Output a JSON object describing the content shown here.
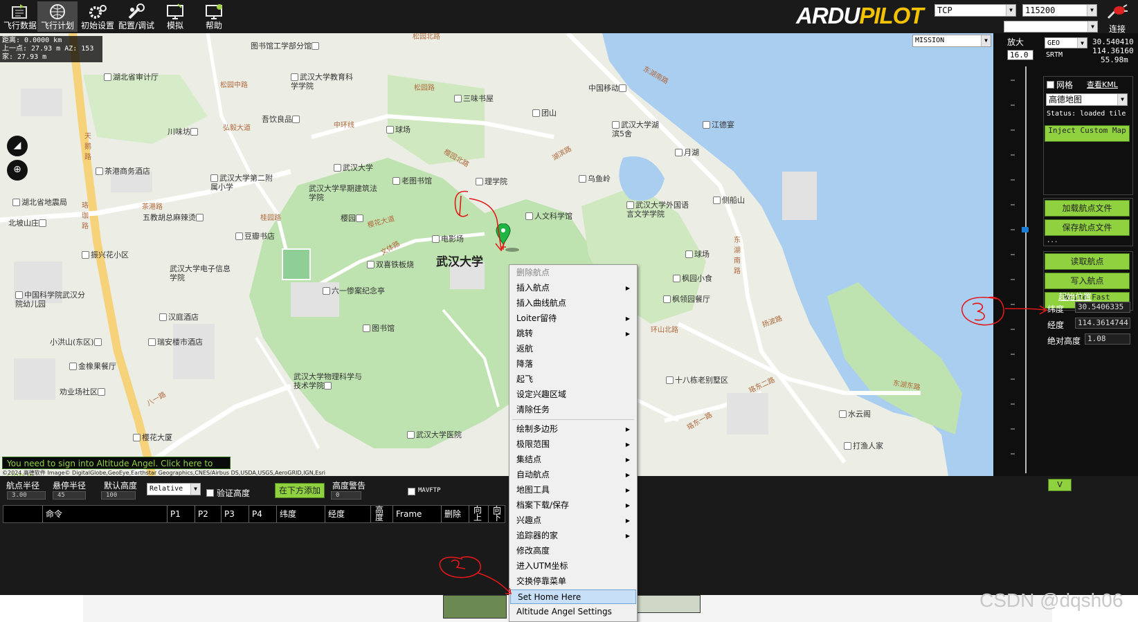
{
  "toolbar": {
    "items": [
      {
        "label": "飞行数据",
        "icon": "flight-data-icon"
      },
      {
        "label": "飞行计划",
        "icon": "flight-plan-icon"
      },
      {
        "label": "初始设置",
        "icon": "initial-setup-icon"
      },
      {
        "label": "配置/调试",
        "icon": "config-tuning-icon"
      },
      {
        "label": "模拟",
        "icon": "simulation-icon"
      },
      {
        "label": "帮助",
        "icon": "help-icon"
      }
    ],
    "active_index": 1,
    "logo_part1": "ARDU",
    "logo_part2": "PILOT",
    "link_type": "TCP",
    "baud_rate": "115200",
    "connect_label": "连接"
  },
  "map_info": {
    "line1": "距离: 0.0000 km",
    "line2": "上一点: 27.93 m AZ: 153",
    "line3": "家: 27.93 m"
  },
  "map_places": {
    "p1": "图书馆工学部分馆",
    "p2": "湖北省审计厅",
    "p3": "武汉大学教育科学学院",
    "p4": "中国移动",
    "p5": "三味书屋",
    "p6": "团山",
    "p7": "吾饮良品",
    "p8": "川味坊",
    "p9": "球场",
    "p10": "武汉大学湖滨5舍",
    "p11": "江德宴",
    "p12": "茶港商务酒店",
    "p13": "武汉大学",
    "p14": "月湖",
    "p15": "乌鱼岭",
    "p16": "武汉大学第二附属小学",
    "p17": "老图书馆",
    "p18": "理学院",
    "p19": "武汉大学早期建筑法学院",
    "p20": "湖北省地震局",
    "p21": "武汉大学外国语言文学学院",
    "p22": "侧船山",
    "p23": "北坡山庄",
    "p24": "五教胡总麻辣烫",
    "p25": "樱园",
    "p26": "人文科学馆",
    "p27": "豆瓣书店",
    "p28": "电影场",
    "p29": "振兴花小区",
    "p30": "双喜铁板烧",
    "p31": "武汉大学",
    "p32": "球场",
    "p33": "武汉大学电子信息学院",
    "p34": "枫园小食",
    "p35": "中国科学院武汉分院幼儿园",
    "p36": "六一惨案纪念亭",
    "p37": "枫领园餐厅",
    "p38": "汉庭酒店",
    "p39": "图书馆",
    "p40": "小洪山(东区)",
    "p41": "瑞安楼市酒店",
    "p42": "金橡果餐厅",
    "p43": "十八栋老别墅区",
    "p44": "劝业场社区",
    "p45": "武汉大学物理科学与技术学院",
    "p46": "水云阁",
    "p47": "樱花大厦",
    "p48": "武汉大学医院",
    "p49": "打渔人家"
  },
  "map_roads": {
    "r1": "松园北路",
    "r2": "东湖南路",
    "r3": "松园中路",
    "r4": "松园路",
    "r5": "中环线",
    "r6": "弘毅大道",
    "r7": "天鹅路",
    "r8": "樱园北路",
    "r9": "湖滨路",
    "r10": "珞珈路",
    "r11": "茶港路",
    "r12": "樱花大道",
    "r13": "桂园路",
    "r14": "文体路",
    "r15": "东湖南路",
    "r16": "扬波路",
    "r17": "环山北路",
    "r18": "东湖东路",
    "r19": "珞东二路",
    "r20": "八一路",
    "r21": "珞东一路"
  },
  "map_banner": "You need to sign into Altitude Angel. Click here to sign in.",
  "map_attrib": "©2024 高德软件 Image© DigitalGlobe,GeoEye,Earthstar Geographics,CNES/Airbus DS,USDA,USGS,AeroGRID,IGN,Esri",
  "right_panel": {
    "mission_select": "MISSION",
    "zoom_label": "放大",
    "zoom_value": "16.0",
    "coord_mode": "GEO",
    "coord_lat": "30.540410",
    "coord_lng": "114.36160",
    "srtm_label": "SRTM",
    "srtm_alt": "55.98m",
    "grid_label": "网格",
    "kml_link": "查看KML",
    "map_provider": "高德地图",
    "status_text": "Status: loaded tile",
    "inject_btn": "Inject Custom Map",
    "load_wp": "加载航点文件",
    "save_wp": "保存航点文件",
    "dots": "...",
    "read_wp": "读取航点",
    "write_wp": "写入航点",
    "write_fast": "Write Fast",
    "home_title": "起始位置",
    "lat_label": "纬度",
    "lat_value": "30.5406335",
    "lng_label": "经度",
    "lng_value": "114.3614744",
    "alt_label": "绝对高度",
    "alt_value": "1.08",
    "collapse_btn": "V"
  },
  "bottom_panel": {
    "wp_radius_label": "航点半径",
    "wp_radius": "3.00",
    "loiter_radius_label": "悬停半径",
    "loiter_radius": "45",
    "default_alt_label": "默认高度",
    "default_alt": "100",
    "alt_frame": "Relative",
    "verify_alt": "验证高度",
    "add_below": "在下方添加",
    "alt_warn_label": "高度警告",
    "alt_warn": "0",
    "mavftp": "MAVFTP",
    "columns": [
      "命令",
      "P1",
      "P2",
      "P3",
      "P4",
      "纬度",
      "经度",
      "高度",
      "Frame",
      "删除",
      "向上",
      "向下"
    ]
  },
  "context_menu": [
    {
      "label": "删除航点",
      "disabled": true,
      "sub": false
    },
    {
      "label": "插入航点",
      "sub": true
    },
    {
      "label": "插入曲线航点",
      "sub": false
    },
    {
      "label": "Loiter留待",
      "sub": true
    },
    {
      "label": "跳转",
      "sub": true
    },
    {
      "label": "返航",
      "sub": false
    },
    {
      "label": "降落",
      "sub": false
    },
    {
      "label": "起飞",
      "sub": false
    },
    {
      "label": "设定兴趣区域",
      "sub": false
    },
    {
      "label": "清除任务",
      "sub": false
    },
    {
      "label": "绘制多边形",
      "sub": true
    },
    {
      "label": "极限范围",
      "sub": true
    },
    {
      "label": "集结点",
      "sub": true
    },
    {
      "label": "自动航点",
      "sub": true
    },
    {
      "label": "地图工具",
      "sub": true
    },
    {
      "label": "档案下载/保存",
      "sub": true
    },
    {
      "label": "兴趣点",
      "sub": true
    },
    {
      "label": "追踪器的家",
      "sub": true
    },
    {
      "label": "修改高度",
      "sub": false
    },
    {
      "label": "进入UTM坐标",
      "sub": false
    },
    {
      "label": "交换停靠菜单",
      "sub": false
    },
    {
      "label": "Set Home Here",
      "highlight": true,
      "sub": false
    },
    {
      "label": "Altitude Angel Settings",
      "sub": false
    }
  ],
  "watermark": "CSDN @dqsh06",
  "colors": {
    "accent_green": "#8fd13f",
    "water": "#a9cef0",
    "park": "#bfe3b0",
    "main_road": "#f6d27a",
    "dark_bg": "#1a1a1a"
  }
}
